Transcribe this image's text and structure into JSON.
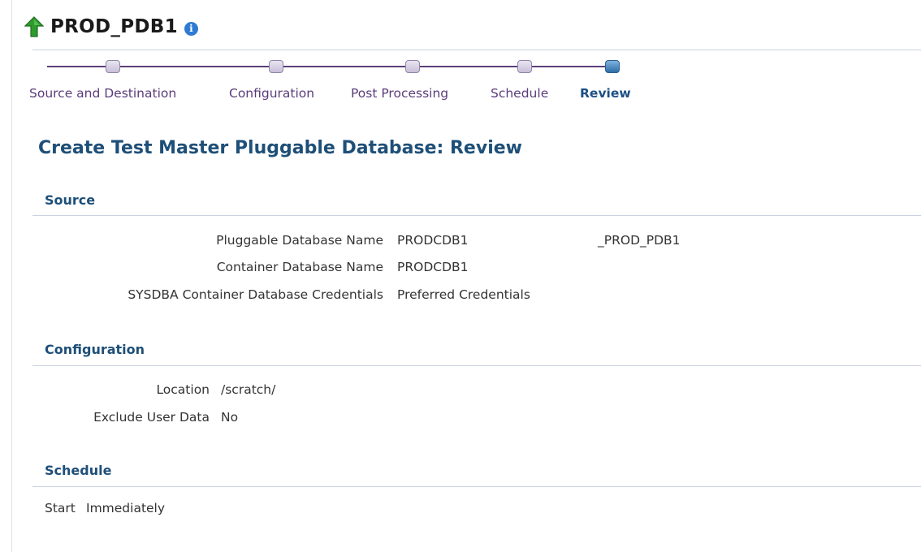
{
  "page": {
    "title": "PROD_PDB1",
    "info_icon": "info-icon",
    "up_icon": "green-up-arrow-icon"
  },
  "train": {
    "stops": [
      {
        "label": "Source and Destination",
        "state": "visited"
      },
      {
        "label": "Configuration",
        "state": "visited"
      },
      {
        "label": "Post Processing",
        "state": "visited"
      },
      {
        "label": "Schedule",
        "state": "visited"
      },
      {
        "label": "Review",
        "state": "current"
      }
    ]
  },
  "heading": "Create Test Master Pluggable Database: Review",
  "source": {
    "title": "Source",
    "pdb_name_label": "Pluggable Database Name",
    "pdb_name_value": "PRODCDB1",
    "pdb_name_value2": "_PROD_PDB1",
    "cdb_name_label": "Container Database Name",
    "cdb_name_value": "PRODCDB1",
    "creds_label": "SYSDBA Container Database Credentials",
    "creds_value": "Preferred Credentials"
  },
  "configuration": {
    "title": "Configuration",
    "location_label": "Location",
    "location_value": "/scratch/",
    "exclude_label": "Exclude User Data",
    "exclude_value": "No"
  },
  "schedule": {
    "title": "Schedule",
    "start_label": "Start",
    "start_value": "Immediately"
  },
  "colors": {
    "heading": "#1e4f78",
    "train_visited": "#5b3c7a",
    "train_current": "#1d4f86",
    "up_arrow": "#2e9b2e",
    "info": "#2f7ad2"
  }
}
